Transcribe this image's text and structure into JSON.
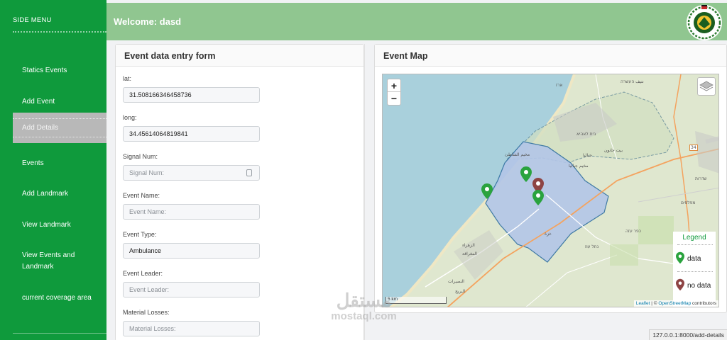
{
  "sidebar": {
    "title": "SIDE MENU",
    "items": [
      {
        "label": "Statics Events"
      },
      {
        "label": "Add Event"
      },
      {
        "label": "Add Details"
      },
      {
        "label": "Events"
      },
      {
        "label": "Add Landmark"
      },
      {
        "label": "View Landmark"
      },
      {
        "label": "View Events and Landmark"
      },
      {
        "label": "current coverage area"
      }
    ],
    "active_index": 2
  },
  "header": {
    "welcome": "Welcome: dasd",
    "logo_icon": "ministry-seal-logo"
  },
  "form": {
    "title": "Event data entry form",
    "fields": [
      {
        "label": "lat:",
        "value": "31.508166346458736",
        "placeholder": ""
      },
      {
        "label": "long:",
        "value": "34.45614064819841",
        "placeholder": ""
      },
      {
        "label": "Signal Num:",
        "value": "",
        "placeholder": "Signal Num:"
      },
      {
        "label": "Event Name:",
        "value": "",
        "placeholder": "Event Name:"
      },
      {
        "label": "Event Type:",
        "value": "Ambulance",
        "placeholder": ""
      },
      {
        "label": "Event Leader:",
        "value": "",
        "placeholder": "Event Leader:"
      },
      {
        "label": "Material Losses:",
        "value": "",
        "placeholder": "Material Losses:"
      }
    ]
  },
  "map": {
    "title": "Event Map",
    "zoom_in": "+",
    "zoom_out": "−",
    "legend": {
      "title": "Legend",
      "data_label": "data",
      "no_data_label": "no data"
    },
    "scale": "5 km",
    "attribution": {
      "leaflet": "Leaflet",
      "sep": " | © ",
      "osm": "OpenStreetMap",
      "suffix": " contributors"
    },
    "colors": {
      "sea": "#a9d0dc",
      "land": "#e1e7cc",
      "area_fill": "#b3c6e8",
      "area_stroke": "#2f6fa0",
      "data_marker": "#2aa33e",
      "no_data_marker": "#8e4444"
    },
    "place_labels": [
      "בית לאהיא",
      "بيت حانون",
      "جباليا",
      "مخيم جباليا",
      "مخيم الشاطئ",
      "غزة",
      "الزهراء",
      "المغراقة",
      "النصيرات",
      "البريج",
      "نتيف העשרה",
      "ארז",
      "שדרות",
      "כפר עזה",
      "נחל עוז",
      "מפלסים",
      "34"
    ]
  },
  "watermark": {
    "arabic": "مستقل",
    "latin": "mostaql.com"
  },
  "status_url": "127.0.0.1:8000/add-details"
}
